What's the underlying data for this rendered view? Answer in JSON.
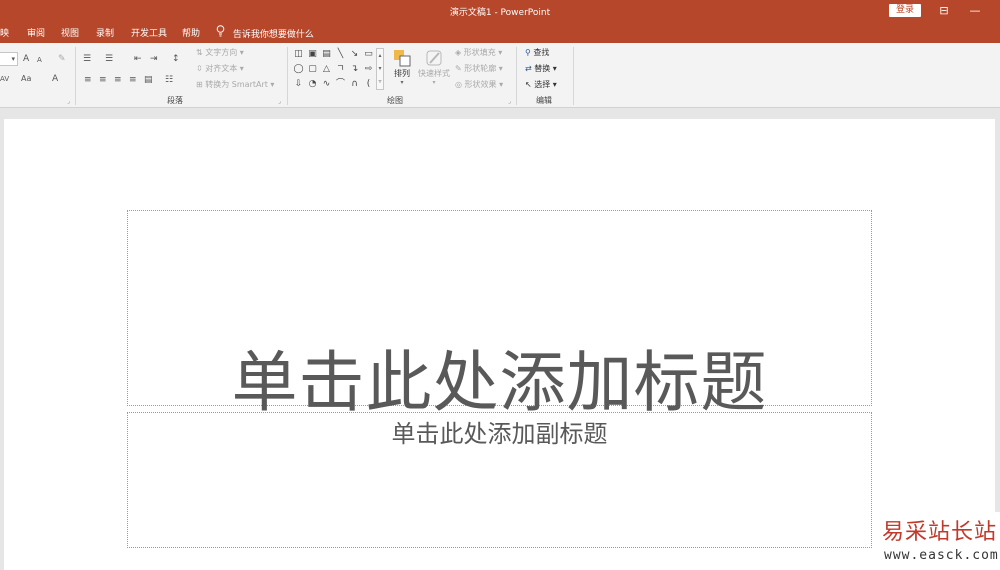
{
  "titlebar": {
    "document_title": "演示文稿1 - PowerPoint",
    "login_label": "登录",
    "restore_icon": "ribbon-display-icon",
    "minimize_label": "—"
  },
  "tabs": [
    {
      "label": "映"
    },
    {
      "label": "审阅"
    },
    {
      "label": "视图"
    },
    {
      "label": "录制"
    },
    {
      "label": "开发工具"
    },
    {
      "label": "帮助"
    }
  ],
  "tell_me": {
    "label": "告诉我你想要做什么",
    "icon": "lightbulb-icon"
  },
  "ribbon": {
    "font_group": {
      "font_size": "",
      "size_caret": "▾",
      "grow": "A",
      "shrink": "A",
      "clear": "Aa",
      "spacing": "AV",
      "case": "Aa",
      "color": "A"
    },
    "paragraph_group": {
      "label": "段落",
      "text_direction": "文字方向",
      "align_text": "对齐文本",
      "convert_smartart": "转换为 SmartArt"
    },
    "drawing_group": {
      "label": "绘图",
      "arrange": "排列",
      "quick_styles": "快速样式",
      "shape_fill": "形状填充",
      "shape_outline": "形状轮廓",
      "shape_effects": "形状效果"
    },
    "editing_group": {
      "label": "编辑",
      "find": "查找",
      "replace": "替换",
      "select": "选择"
    }
  },
  "slide": {
    "title_placeholder": "单击此处添加标题",
    "subtitle_placeholder": "单击此处添加副标题"
  },
  "watermark": {
    "name": "易采站长站",
    "url": "www.easck.com",
    "color": "#c0392b"
  },
  "colors": {
    "accent": "#b7472a"
  }
}
